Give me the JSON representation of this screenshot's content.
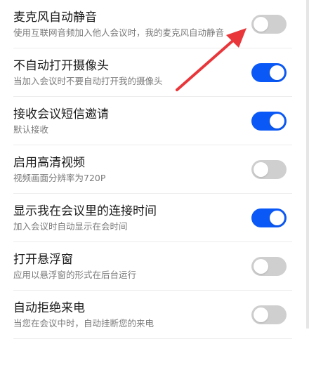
{
  "settings": [
    {
      "title": "麦克风自动静音",
      "subtitle": "使用互联网音频加入他人会议时，我的麦克风自动静音",
      "enabled": false
    },
    {
      "title": "不自动打开摄像头",
      "subtitle": "当加入会议时不要自动打开我的摄像头",
      "enabled": true
    },
    {
      "title": "接收会议短信邀请",
      "subtitle": "默认接收",
      "enabled": true
    },
    {
      "title": "启用高清视频",
      "subtitle": "视频画面分辨率为720P",
      "enabled": false
    },
    {
      "title": "显示我在会议里的连接时间",
      "subtitle": "加入会议时自动显示在会时间",
      "enabled": true
    },
    {
      "title": "打开悬浮窗",
      "subtitle": "应用以悬浮窗的形式在后台运行",
      "enabled": false
    },
    {
      "title": "自动拒绝来电",
      "subtitle": "当您在会议中时，自动挂断您的来电",
      "enabled": false
    }
  ],
  "colors": {
    "toggle_on": "#0a59f7",
    "toggle_off": "#cfcfcf",
    "annotation_arrow": "#e8363a"
  }
}
